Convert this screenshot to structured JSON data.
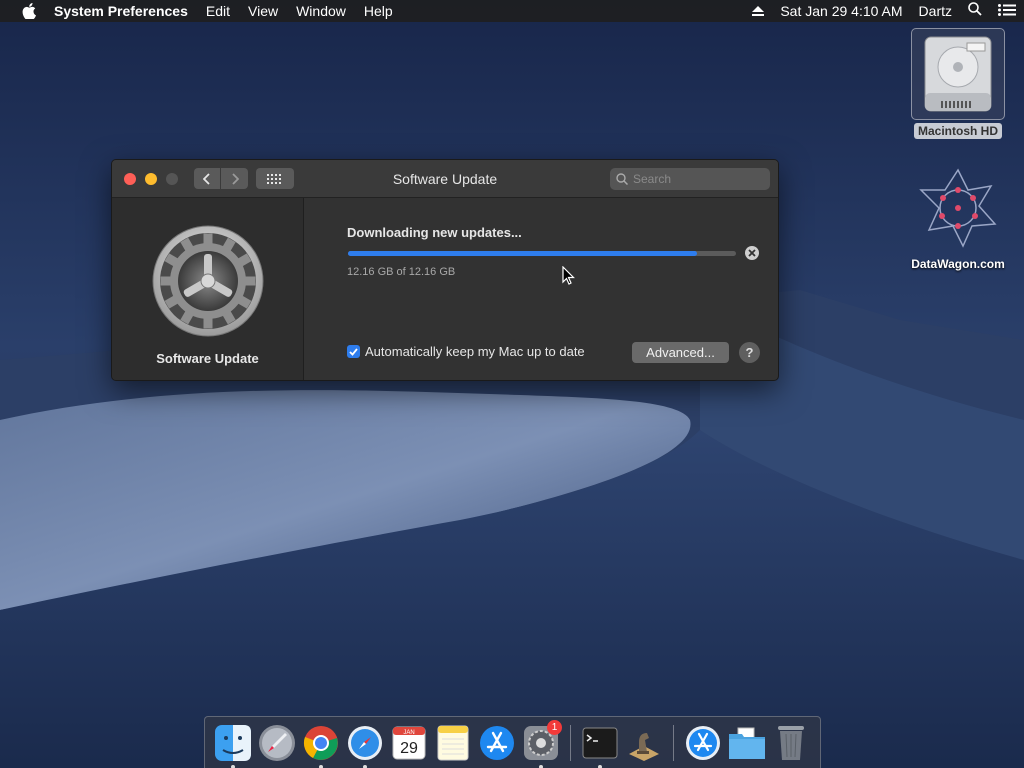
{
  "menubar": {
    "app_name": "System Preferences",
    "menus": [
      "Edit",
      "View",
      "Window",
      "Help"
    ],
    "datetime": "Sat Jan 29  4:10 AM",
    "user": "Dartz"
  },
  "desktop": {
    "icons": [
      {
        "label": "Macintosh HD"
      },
      {
        "label": "DataWagon.com"
      }
    ]
  },
  "window": {
    "title": "Software Update",
    "search_placeholder": "Search",
    "sidebar_label": "Software Update",
    "status_title": "Downloading new updates...",
    "progress_fraction": 0.9,
    "progress_text": "12.16 GB of 12.16 GB",
    "auto_update_label": "Automatically keep my Mac up to date",
    "auto_update_checked": true,
    "advanced_label": "Advanced...",
    "help_label": "?"
  },
  "dock": {
    "apps": [
      "Finder",
      "Launchpad",
      "Google Chrome",
      "Safari",
      "Calendar",
      "Notes",
      "App Store",
      "System Preferences",
      "Terminal",
      "Chess",
      "Applications",
      "Documents",
      "Trash"
    ],
    "calendar_month": "JAN",
    "calendar_day": "29",
    "sysprefs_badge": "1"
  },
  "colors": {
    "accent": "#2e7ded",
    "close": "#fe5f57",
    "minimize": "#febc2e"
  }
}
